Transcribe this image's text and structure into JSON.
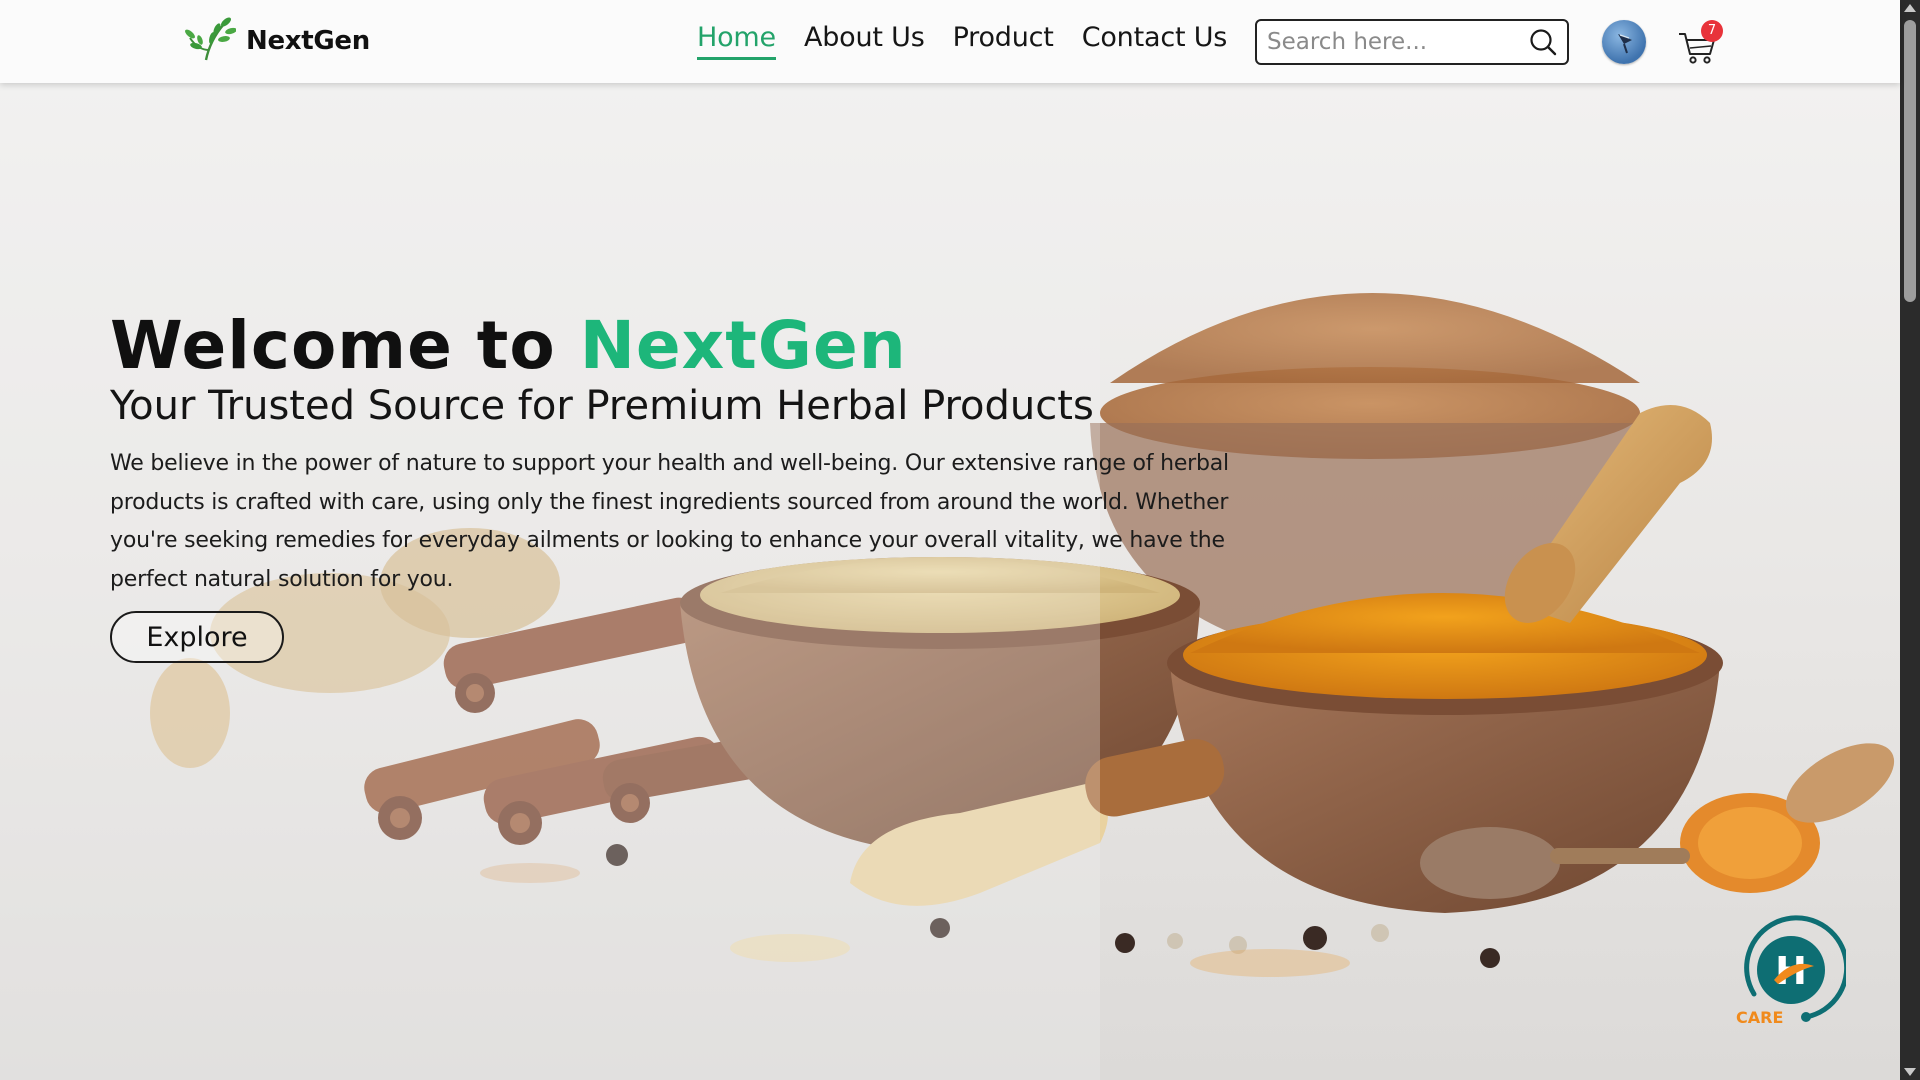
{
  "header": {
    "logo_text": "NextGen",
    "nav": [
      {
        "label": "Home",
        "active": true
      },
      {
        "label": "About Us",
        "active": false
      },
      {
        "label": "Product",
        "active": false
      },
      {
        "label": "Contact Us",
        "active": false
      }
    ],
    "search": {
      "placeholder": "Search here...",
      "value": ""
    },
    "cart_count": "7",
    "icons": {
      "logo": "leaf-sprig-icon",
      "search": "search-icon",
      "avatar": "user-avatar",
      "cart": "cart-icon"
    }
  },
  "hero": {
    "title_prefix": "Welcome to ",
    "title_brand": "NextGen",
    "subtitle": "Your Trusted Source for Premium Herbal Products",
    "description": "We believe in the power of nature to support your health and well-being. Our extensive range of herbal products is crafted with care, using only the finest ingredients sourced from around the world. Whether you're seeking remedies for everyday ailments or looking to enhance your overall vitality, we have the perfect natural solution for you.",
    "explore_label": "Explore"
  },
  "care_widget": {
    "letter": "H",
    "label": "CARE"
  },
  "colors": {
    "brand_green": "#1db67a",
    "nav_active": "#23a36a",
    "badge_red": "#e8333a",
    "care_teal": "#0e6e73",
    "care_orange": "#f08a1c"
  }
}
